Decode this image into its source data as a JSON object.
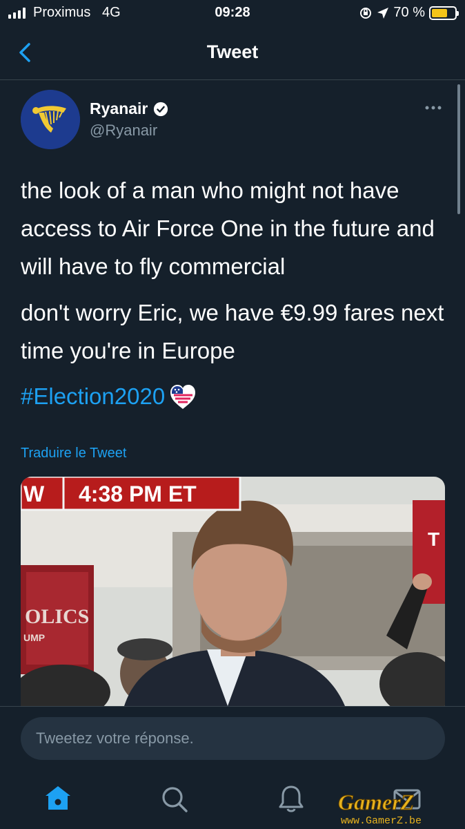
{
  "status_bar": {
    "carrier": "Proximus",
    "network": "4G",
    "time": "09:28",
    "battery": "70 %",
    "battery_level": 0.7
  },
  "nav": {
    "title": "Tweet",
    "back_icon": "chevron-left-icon"
  },
  "tweet": {
    "display_name": "Ryanair",
    "handle": "@Ryanair",
    "verified": true,
    "text_paragraphs": [
      "the look of a man who might not have access to Air Force One in the future and will have to fly commercial",
      "don't worry Eric, we have €9.99 fares next time you're in Europe"
    ],
    "hashtag": "#Election2020",
    "translate_link": "Traduire le Tweet",
    "media": {
      "banner_left": "W",
      "banner_time": "4:38 PM ET",
      "sign_text_1": "OLICS",
      "sign_text_2": "UMP",
      "sign_text_right": "T"
    }
  },
  "reply": {
    "placeholder": "Tweetez votre réponse."
  },
  "tabbar": {
    "items": [
      "home-icon",
      "search-icon",
      "notifications-icon",
      "messages-icon"
    ]
  },
  "watermark": {
    "brand": "GamerZ",
    "url": "www.GamerZ.be"
  },
  "colors": {
    "background": "#15202b",
    "accent": "#1da1f2",
    "muted": "#8899a6",
    "divider": "#38444d"
  }
}
